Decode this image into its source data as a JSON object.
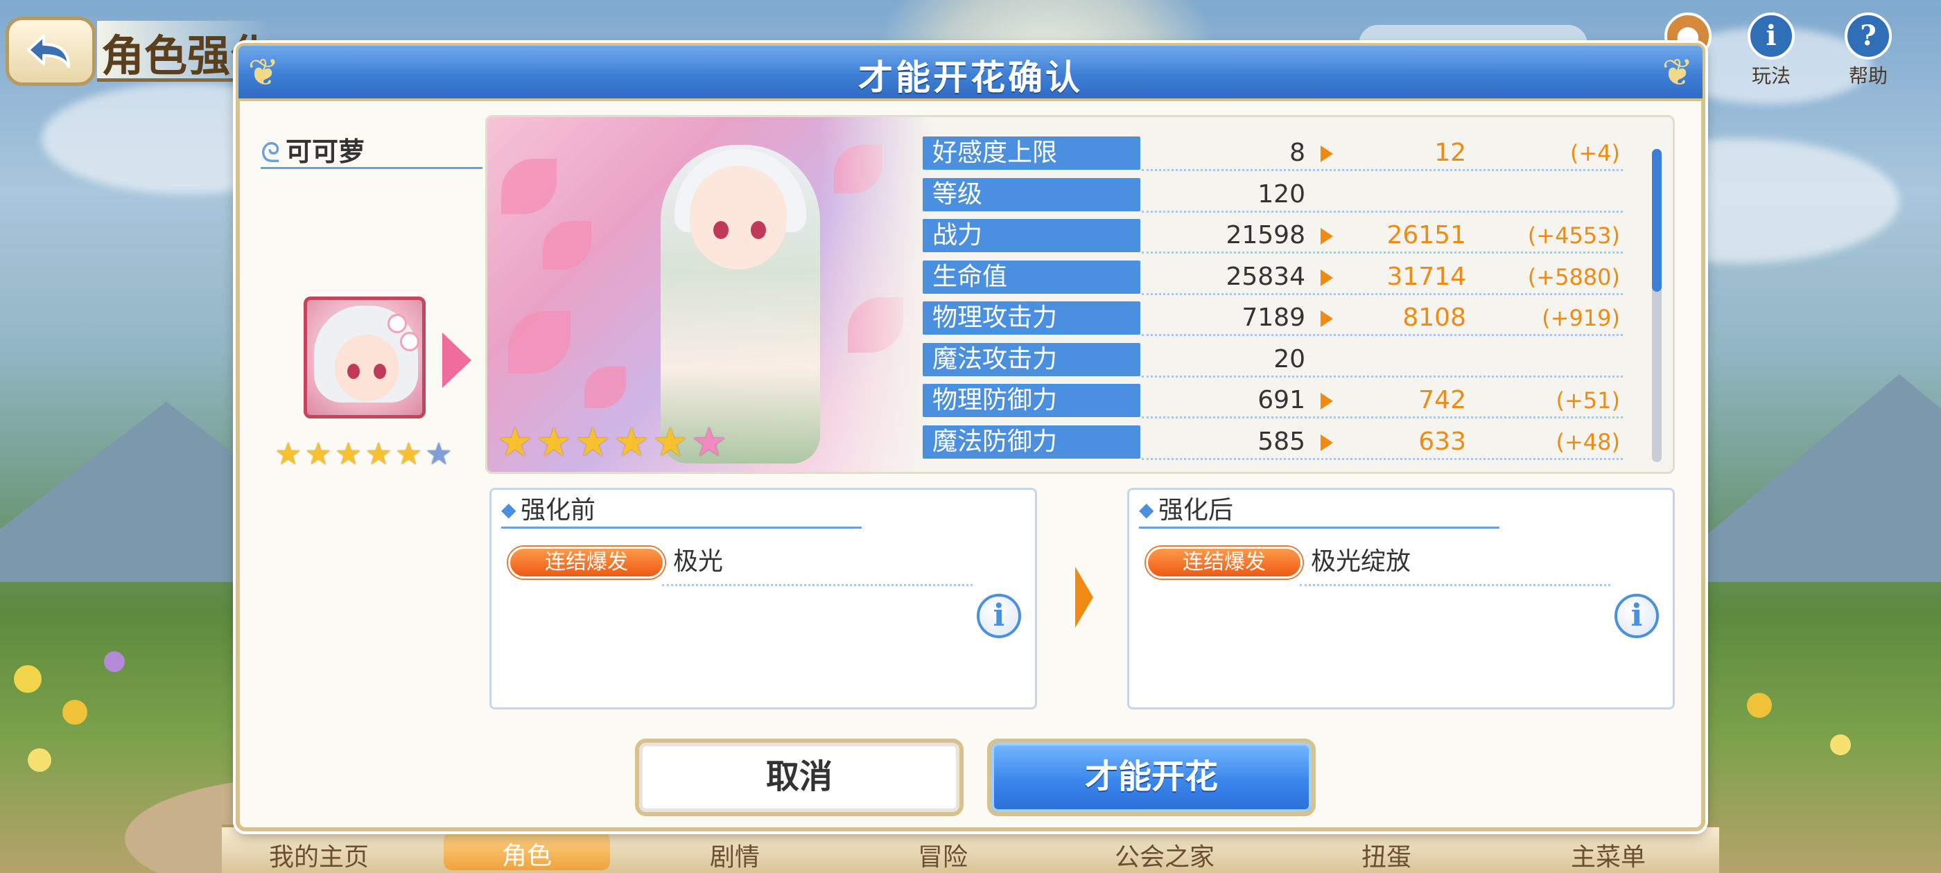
{
  "hud": {
    "back_icon": "back-arrow-icon",
    "page_title": "角色强化",
    "currency_icon": "mana-coin-icon",
    "currency_value": "",
    "buttons": [
      {
        "icon": "bag-icon",
        "label": ""
      },
      {
        "icon": "info-icon",
        "label": "玩法"
      },
      {
        "icon": "help-icon",
        "label": "帮助"
      }
    ]
  },
  "bottom_nav": {
    "tabs": [
      "我的主页",
      "角色",
      "剧情",
      "冒险",
      "公会之家",
      "扭蛋",
      "主菜单"
    ],
    "active": "角色"
  },
  "modal": {
    "title": "才能开花确认",
    "character": {
      "name": "可可萝",
      "stars_filled": 5,
      "stars_total": 6,
      "card_stars_filled": 5,
      "card_stars_total": 6
    },
    "stats": [
      {
        "label": "好感度上限",
        "current": "8",
        "new": "12",
        "delta": "(+4)"
      },
      {
        "label": "等级",
        "current": "120",
        "new": "",
        "delta": ""
      },
      {
        "label": "战力",
        "current": "21598",
        "new": "26151",
        "delta": "(+4553)"
      },
      {
        "label": "生命值",
        "current": "25834",
        "new": "31714",
        "delta": "(+5880)"
      },
      {
        "label": "物理攻击力",
        "current": "7189",
        "new": "8108",
        "delta": "(+919)"
      },
      {
        "label": "魔法攻击力",
        "current": "20",
        "new": "",
        "delta": ""
      },
      {
        "label": "物理防御力",
        "current": "691",
        "new": "742",
        "delta": "(+51)"
      },
      {
        "label": "魔法防御力",
        "current": "585",
        "new": "633",
        "delta": "(+48)"
      }
    ],
    "scroll_position": 0,
    "before": {
      "header": "强化前",
      "skill_type": "连结爆发",
      "skill_name": "极光",
      "info_icon": "info-icon"
    },
    "after": {
      "header": "强化后",
      "skill_type": "连结爆发",
      "skill_name": "极光绽放",
      "info_icon": "info-icon"
    },
    "cancel_label": "取消",
    "confirm_label": "才能开花"
  },
  "colors": {
    "header_blue": "#3f7fd6",
    "label_blue": "#4a8fe0",
    "highlight_orange": "#f08a10",
    "border_gold": "#d8c18a"
  }
}
